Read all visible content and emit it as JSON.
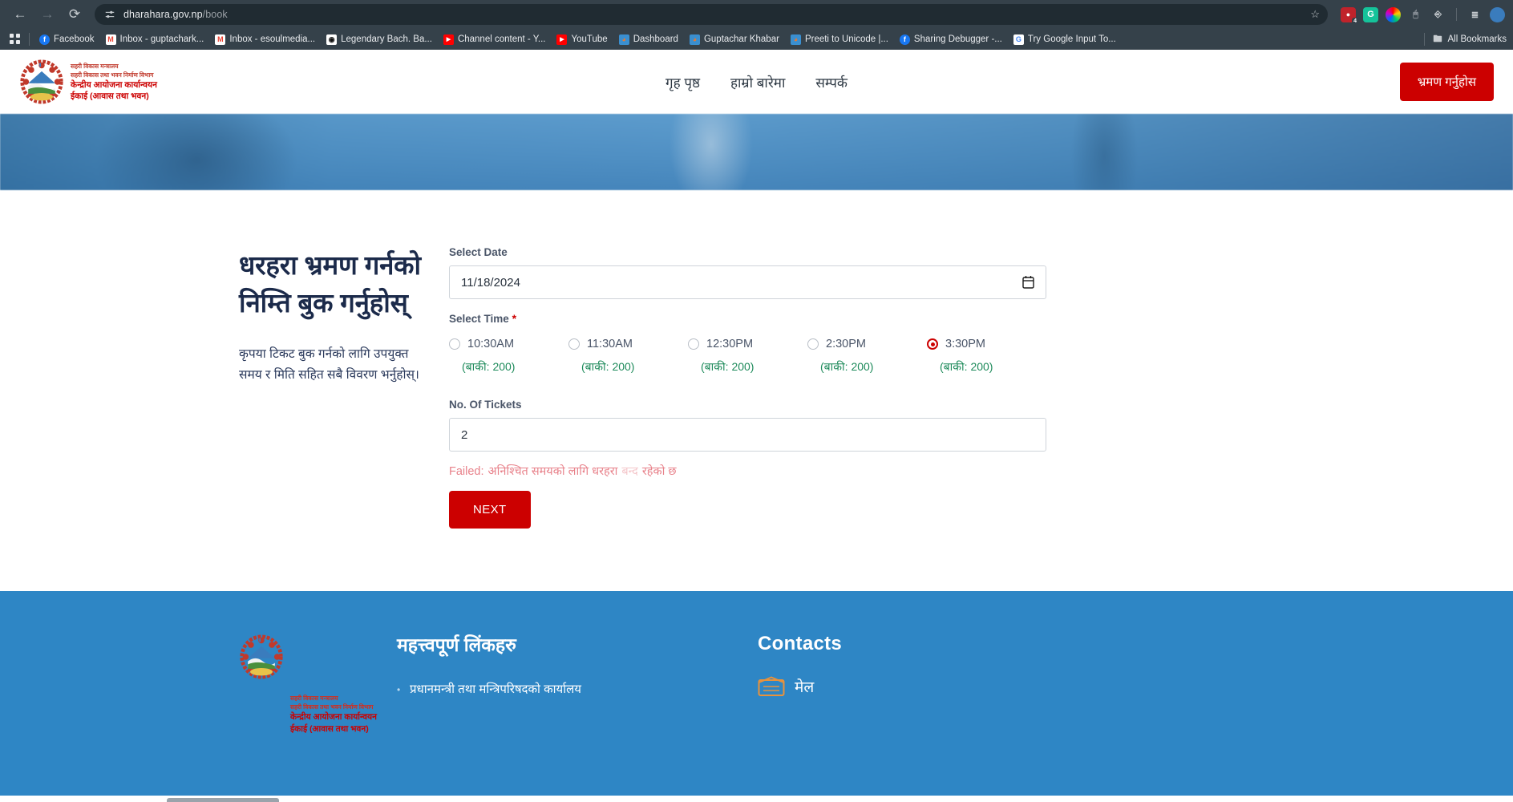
{
  "browser": {
    "back_icon": "back-arrow-icon",
    "forward_icon": "forward-arrow-icon",
    "reload_icon": "reload-icon",
    "site_settings_icon": "tune-icon",
    "url_domain": "dharahara.gov.np",
    "url_path": "/book",
    "url_full": "dharahara.gov.np/book",
    "star_icon": "bookmark-star-icon",
    "extensions": [
      {
        "name": "adblock-extension",
        "glyph": "●",
        "color": "#c0232b",
        "badge": "4"
      },
      {
        "name": "grammarly-extension",
        "glyph": "G",
        "color": "#15c39a",
        "badge": ""
      },
      {
        "name": "colorzilla-extension",
        "glyph": "●",
        "color": "#1b1b1b",
        "badge": ""
      },
      {
        "name": "mouse-extension",
        "glyph": "●",
        "color": "#8a9199",
        "badge": ""
      },
      {
        "name": "puzzle-extensions-icon",
        "glyph": "⬜",
        "color": "#9aa0a6",
        "badge": ""
      },
      {
        "name": "reading-list-icon",
        "glyph": "≡",
        "color": "#c8cdd1",
        "badge": ""
      },
      {
        "name": "profile-avatar",
        "glyph": "●",
        "color": "#3a7cbd",
        "badge": ""
      }
    ],
    "apps_icon": "apps-grid-icon",
    "bookmarks": [
      {
        "label": "Facebook",
        "icon": "facebook-icon",
        "glyph": "f",
        "color": "#1877f2"
      },
      {
        "label": "Inbox - guptachark...",
        "icon": "gmail-icon",
        "glyph": "M",
        "color": "#ffffff"
      },
      {
        "label": "Inbox - esoulmedia...",
        "icon": "gmail-icon",
        "glyph": "M",
        "color": "#ffffff"
      },
      {
        "label": "Legendary Bach. Ba...",
        "icon": "globe-icon",
        "glyph": "◉",
        "color": "#ffffff"
      },
      {
        "label": "Channel content - Y...",
        "icon": "youtube-icon",
        "glyph": "▶",
        "color": "#ff0000"
      },
      {
        "label": "YouTube",
        "icon": "youtube-icon",
        "glyph": "▶",
        "color": "#ff0000"
      },
      {
        "label": "Dashboard",
        "icon": "joomla-icon",
        "glyph": "◕",
        "color": "#e07b39"
      },
      {
        "label": "Guptachar Khabar",
        "icon": "joomla-icon",
        "glyph": "◕",
        "color": "#e07b39"
      },
      {
        "label": "Preeti to Unicode |...",
        "icon": "joomla-icon",
        "glyph": "◕",
        "color": "#e07b39"
      },
      {
        "label": "Sharing Debugger -...",
        "icon": "facebook-icon",
        "glyph": "f",
        "color": "#1877f2"
      },
      {
        "label": "Try Google Input To...",
        "icon": "google-icon",
        "glyph": "G",
        "color": "#ffffff"
      }
    ],
    "all_bookmarks_label": "All Bookmarks",
    "all_bookmarks_icon": "folder-icon"
  },
  "site_header": {
    "emblem_icon": "nepal-government-emblem",
    "brand_line1": "सहरी विकास मन्त्रालय",
    "brand_line2": "सहरी विकास तथा भवन निर्माण विभाग",
    "brand_line3": "केन्द्रीय आयोजना कार्यान्वयन",
    "brand_line4": "ईकाई (आवास तथा भवन)",
    "nav": [
      {
        "label": "गृह पृष्ठ",
        "name": "nav-home"
      },
      {
        "label": "हाम्रो बारेमा",
        "name": "nav-about"
      },
      {
        "label": "सम्पर्क",
        "name": "nav-contact"
      }
    ],
    "cta_label": "भ्रमण गर्नुहोस",
    "cta_color": "#cc0000"
  },
  "main": {
    "title": "धरहरा भ्रमण गर्नको निम्ति बुक गर्नुहोस्",
    "subtitle": "कृपया टिकट बुक गर्नको लागि उपयुक्त समय र मिति सहित सबै विवरण भर्नुहोस्।",
    "form": {
      "date_label": "Select Date",
      "date_value": "11/18/2024",
      "date_icon": "calendar-icon",
      "time_label": "Select Time",
      "time_required_mark": "*",
      "time_options": [
        {
          "label": "10:30AM",
          "remaining": "(बाकी: 200)",
          "selected": false
        },
        {
          "label": "11:30AM",
          "remaining": "(बाकी: 200)",
          "selected": false
        },
        {
          "label": "12:30PM",
          "remaining": "(बाकी: 200)",
          "selected": false
        },
        {
          "label": "2:30PM",
          "remaining": "(बाकी: 200)",
          "selected": false
        },
        {
          "label": "3:30PM",
          "remaining": "(बाकी: 200)",
          "selected": true
        }
      ],
      "tickets_label": "No. Of Tickets",
      "tickets_value": "2",
      "error_prefix": "Failed:",
      "error_text_1": "अनिश्चित समयको लागि धरहरा",
      "error_text_2": "बन्द",
      "error_text_3": "रहेको छ",
      "error_color": "#e8818a",
      "next_label": "NEXT"
    }
  },
  "footer": {
    "bg_color": "#2e86c5",
    "emblem_icon": "nepal-government-emblem",
    "brand_line1": "सहरी विकास मन्त्रालय",
    "brand_line2": "सहरी विकास तथा भवन निर्माण विभाग",
    "brand_line3": "केन्द्रीय आयोजना कार्यान्वयन",
    "brand_line4": "ईकाई (आवास तथा भवन)",
    "links_title": "महत्त्वपूर्ण लिंकहरु",
    "links": [
      {
        "label": "प्रधानमन्त्री तथा मन्त्रिपरिषदको कार्यालय"
      }
    ],
    "contacts_title": "Contacts",
    "contact_items": [
      {
        "label": "मेल",
        "icon": "envelope-icon"
      }
    ]
  }
}
